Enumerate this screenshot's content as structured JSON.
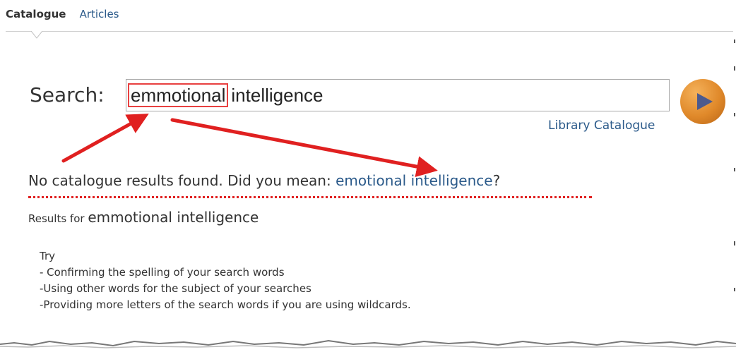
{
  "tabs": [
    {
      "label": "Catalogue",
      "active": true
    },
    {
      "label": "Articles",
      "active": false
    }
  ],
  "search": {
    "label": "Search:",
    "query_word_1": "emmotional",
    "query_word_2": "intelligence",
    "scope_link": "Library Catalogue",
    "go_icon": "play-arrow-icon"
  },
  "noresults": {
    "message": "No catalogue results found. Did you mean: ",
    "suggestion": "emotional intelligence",
    "end": "?"
  },
  "results_for": {
    "label": "Results for ",
    "term": "emmotional intelligence"
  },
  "try": {
    "heading": "Try",
    "items": [
      "- Confirming the spelling of your search words",
      "-Using other words for the subject of your searches",
      "-Providing more letters of the search words if you are using wildcards."
    ]
  },
  "colors": {
    "link": "#2b5a8a",
    "annotation_red": "#e02020",
    "button_orange": "#e0892a"
  }
}
